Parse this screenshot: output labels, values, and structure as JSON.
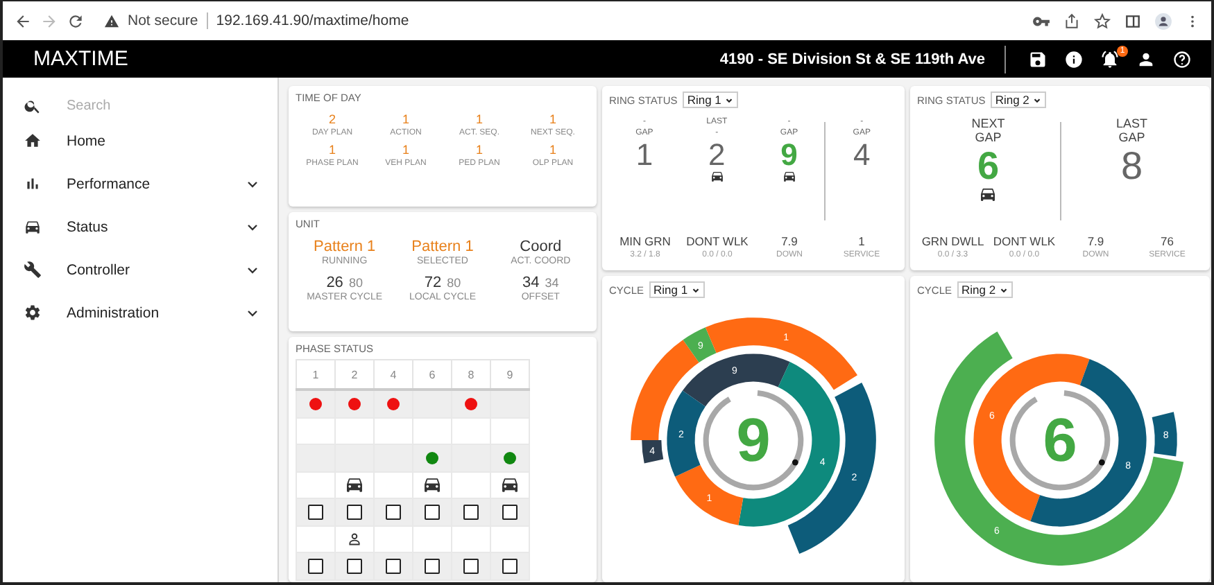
{
  "browser": {
    "security": "Not secure",
    "url": "192.169.41.90/maxtime/home"
  },
  "header": {
    "title": "MAXTIME",
    "location": "4190 - SE Division St & SE 119th Ave",
    "alert_count": "1"
  },
  "sidebar": {
    "search": {
      "placeholder": "Search"
    },
    "items": [
      {
        "label": "Home",
        "expandable": false
      },
      {
        "label": "Performance",
        "expandable": true
      },
      {
        "label": "Status",
        "expandable": true
      },
      {
        "label": "Controller",
        "expandable": true
      },
      {
        "label": "Administration",
        "expandable": true
      }
    ]
  },
  "time_of_day": {
    "title": "TIME OF DAY",
    "fields": [
      {
        "value": "2",
        "label": "DAY PLAN"
      },
      {
        "value": "1",
        "label": "ACTION"
      },
      {
        "value": "1",
        "label": "ACT. SEQ."
      },
      {
        "value": "1",
        "label": "NEXT SEQ."
      },
      {
        "value": "1",
        "label": "PHASE PLAN"
      },
      {
        "value": "1",
        "label": "VEH PLAN"
      },
      {
        "value": "1",
        "label": "PED PLAN"
      },
      {
        "value": "1",
        "label": "OLP PLAN"
      }
    ]
  },
  "unit": {
    "title": "UNIT",
    "modes": [
      {
        "value": "Pattern 1",
        "label": "RUNNING",
        "highlight": true
      },
      {
        "value": "Pattern 1",
        "label": "SELECTED",
        "highlight": true
      },
      {
        "value": "Coord",
        "label": "ACT. COORD",
        "highlight": false
      }
    ],
    "cycles": [
      {
        "value": "26",
        "limit": "80",
        "label": "MASTER CYCLE"
      },
      {
        "value": "72",
        "limit": "80",
        "label": "LOCAL CYCLE"
      },
      {
        "value": "34",
        "limit": "34",
        "label": "OFFSET"
      }
    ]
  },
  "phase_status": {
    "title": "PHASE STATUS",
    "columns": [
      "1",
      "2",
      "4",
      "6",
      "8",
      "9"
    ],
    "rows": [
      {
        "kind": "dot",
        "color": "#ee1111",
        "cells": [
          {
            "on": true
          },
          {
            "on": true
          },
          {
            "on": true
          },
          {
            "on": false
          },
          {
            "on": true
          },
          {
            "on": false
          }
        ]
      },
      {
        "kind": "empty"
      },
      {
        "kind": "dot",
        "color": "#118811",
        "cells": [
          {
            "on": false
          },
          {
            "on": false
          },
          {
            "on": false
          },
          {
            "on": true
          },
          {
            "on": false
          },
          {
            "on": true
          }
        ]
      },
      {
        "kind": "vehicle",
        "cells": [
          {
            "on": false
          },
          {
            "on": true
          },
          {
            "on": false
          },
          {
            "on": true
          },
          {
            "on": false
          },
          {
            "on": true
          }
        ]
      },
      {
        "kind": "checkbox",
        "cells": [
          {
            "checked": false
          },
          {
            "checked": false
          },
          {
            "checked": false
          },
          {
            "checked": false
          },
          {
            "checked": false
          },
          {
            "checked": false
          }
        ]
      },
      {
        "kind": "pedestrian",
        "cells": [
          {
            "on": false
          },
          {
            "on": true
          },
          {
            "on": false
          },
          {
            "on": false
          },
          {
            "on": false
          },
          {
            "on": false
          }
        ]
      },
      {
        "kind": "checkbox",
        "cells": [
          {
            "checked": false
          },
          {
            "checked": false
          },
          {
            "checked": false
          },
          {
            "checked": false
          },
          {
            "checked": false
          },
          {
            "checked": false
          }
        ]
      }
    ]
  },
  "rings": [
    {
      "title": "RING STATUS",
      "ring": "Ring 1",
      "kind": "compact",
      "groups": [
        {
          "phases": [
            {
              "lines": [
                "-",
                "GAP"
              ],
              "number": "1",
              "active": false,
              "vehicle": false
            },
            {
              "lines": [
                "LAST",
                "-"
              ],
              "number": "2",
              "active": false,
              "vehicle": true
            },
            {
              "lines": [
                "-",
                "GAP"
              ],
              "number": "9",
              "active": true,
              "vehicle": true
            }
          ]
        },
        {
          "phases": [
            {
              "lines": [
                "-",
                "GAP"
              ],
              "number": "4",
              "active": false,
              "vehicle": false
            }
          ]
        }
      ],
      "stats": [
        {
          "value": "MIN GRN",
          "detail": "3.2 / 1.8"
        },
        {
          "value": "DONT WLK",
          "detail": "0.0 / 0.0"
        },
        {
          "value": "7.9",
          "detail": "DOWN"
        },
        {
          "value": "1",
          "detail": "SERVICE"
        }
      ]
    },
    {
      "title": "RING STATUS",
      "ring": "Ring 2",
      "kind": "large",
      "groups": [
        {
          "phases": [
            {
              "lines": [
                "NEXT",
                "GAP"
              ],
              "number": "6",
              "active": true,
              "vehicle": true
            }
          ]
        },
        {
          "phases": [
            {
              "lines": [
                "LAST",
                "GAP"
              ],
              "number": "8",
              "active": false,
              "vehicle": false
            }
          ]
        }
      ],
      "stats": [
        {
          "value": "GRN DWLL",
          "detail": "0.0 / 3.3"
        },
        {
          "value": "DONT WLK",
          "detail": "0.0 / 0.0"
        },
        {
          "value": "7.9",
          "detail": "DOWN"
        },
        {
          "value": "76",
          "detail": "SERVICE"
        }
      ]
    }
  ],
  "cycles": [
    {
      "title": "CYCLE",
      "ring": "Ring 1",
      "current": "9",
      "outer": [
        {
          "label": "4",
          "color": "#2c3e50"
        },
        {
          "color": "#ff6a13"
        },
        {
          "label": "9",
          "color": "#4caf50"
        },
        {
          "label": "1",
          "color": "#ff6a13"
        },
        {
          "label": "2",
          "color": "#0d5c7a"
        }
      ],
      "inner": [
        {
          "label": "9",
          "color": "#2c3e50"
        },
        {
          "label": "4",
          "color": "#0e8a7d"
        },
        {
          "label": "1",
          "color": "#ff6a13"
        },
        {
          "label": "2",
          "color": "#0d5c7a"
        }
      ]
    },
    {
      "title": "CYCLE",
      "ring": "Ring 2",
      "current": "6",
      "outer": [
        {
          "label": "6",
          "color": "#4caf50"
        },
        {
          "label": "8",
          "color": "#0d5c7a"
        }
      ],
      "inner": [
        {
          "label": "6",
          "color": "#ff6a13"
        },
        {
          "label": "8",
          "color": "#0d5c7a"
        }
      ]
    }
  ]
}
